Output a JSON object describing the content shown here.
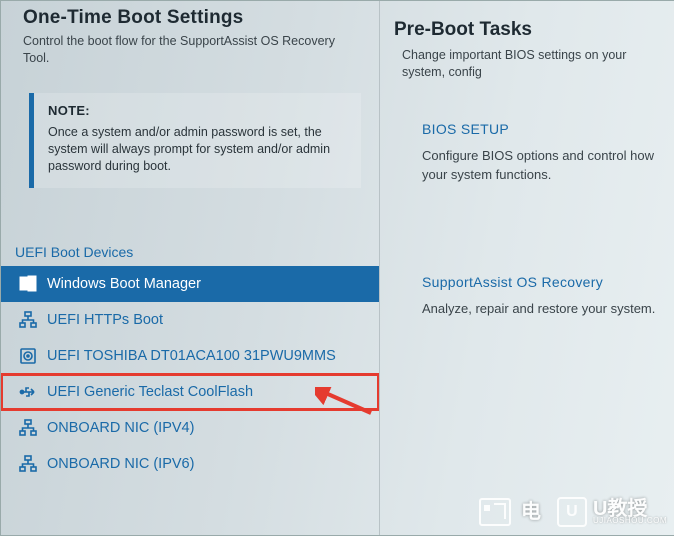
{
  "left": {
    "title": "One-Time Boot Settings",
    "subtitle": "Control the boot flow for the SupportAssist OS Recovery Tool.",
    "note_label": "NOTE:",
    "note_text": "Once a system and/or admin password is set, the system will always prompt for system and/or admin password during boot.",
    "section": "UEFI Boot Devices",
    "devices": [
      {
        "label": "Windows Boot Manager",
        "icon": "windows",
        "state": "selected"
      },
      {
        "label": "UEFI HTTPs Boot",
        "icon": "network",
        "state": "normal"
      },
      {
        "label": "UEFI TOSHIBA DT01ACA100 31PWU9MMS",
        "icon": "disk",
        "state": "normal"
      },
      {
        "label": "UEFI Generic Teclast CoolFlash",
        "icon": "usb",
        "state": "framed"
      },
      {
        "label": "ONBOARD NIC (IPV4)",
        "icon": "network",
        "state": "normal"
      },
      {
        "label": "ONBOARD NIC (IPV6)",
        "icon": "network",
        "state": "normal"
      }
    ]
  },
  "right": {
    "title": "Pre-Boot Tasks",
    "subtitle": "Change important BIOS settings on your system, config",
    "tasks": [
      {
        "header": "BIOS SETUP",
        "desc": "Configure BIOS options and control how your system functions."
      },
      {
        "header": "SupportAssist OS Recovery",
        "desc": "Analyze, repair and restore your system."
      }
    ]
  },
  "watermark": {
    "brand1_label": "电",
    "brand2_u": "U",
    "brand2_label": "U教授",
    "brand2_sub": "UJIAOSHOU.COM"
  },
  "annotation": {
    "arrow_color": "#e53b2f"
  }
}
